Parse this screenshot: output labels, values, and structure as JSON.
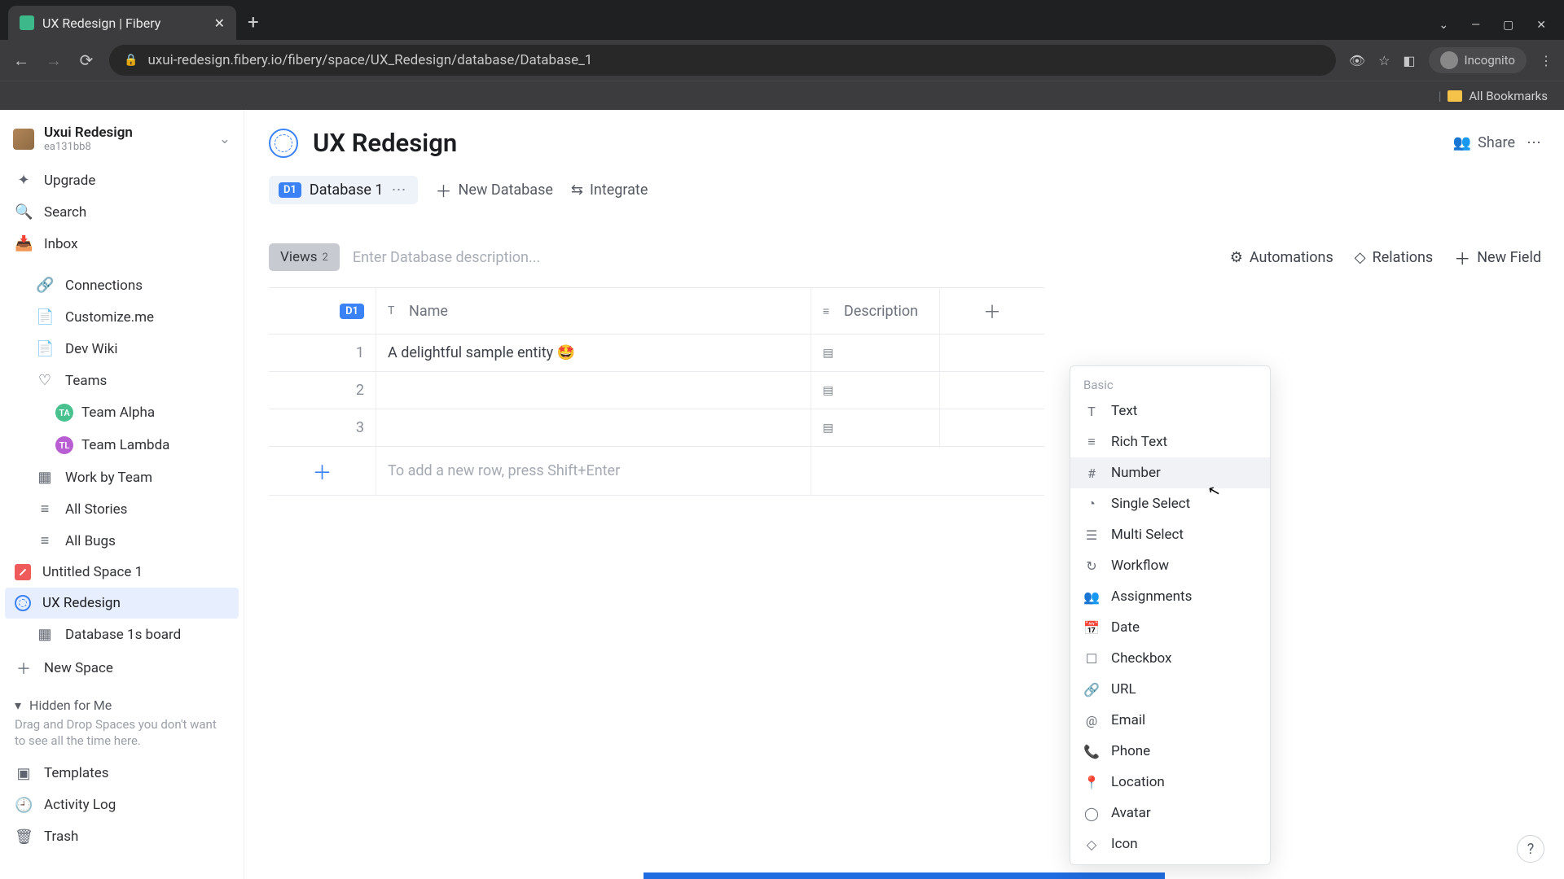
{
  "browser": {
    "tab_title": "UX Redesign | Fibery",
    "url": "uxui-redesign.fibery.io/fibery/space/UX_Redesign/database/Database_1",
    "incognito_label": "Incognito",
    "bookmarks_label": "All Bookmarks"
  },
  "workspace": {
    "name": "Uxui Redesign",
    "id": "ea131bb8"
  },
  "sidebar": {
    "upgrade": "Upgrade",
    "search": "Search",
    "inbox": "Inbox",
    "connections": "Connections",
    "customize": "Customize.me",
    "dev_wiki": "Dev Wiki",
    "teams": "Teams",
    "team_alpha": "Team Alpha",
    "team_alpha_abbr": "TA",
    "team_lambda": "Team Lambda",
    "team_lambda_abbr": "TL",
    "work_by_team": "Work by Team",
    "all_stories": "All Stories",
    "all_bugs": "All Bugs",
    "untitled_space": "Untitled Space 1",
    "ux_redesign": "UX Redesign",
    "db_board": "Database 1s board",
    "new_space": "New Space",
    "hidden_header": "Hidden for Me",
    "hidden_desc": "Drag and Drop Spaces you don't want to see all the time here.",
    "templates": "Templates",
    "activity_log": "Activity Log",
    "trash": "Trash"
  },
  "page": {
    "title": "UX Redesign",
    "share": "Share",
    "db_chip_badge": "D1",
    "db_chip_name": "Database 1",
    "new_database": "New Database",
    "integrate": "Integrate",
    "views_label": "Views",
    "views_count": "2",
    "desc_placeholder": "Enter Database description...",
    "automations": "Automations",
    "relations": "Relations",
    "new_field": "New Field"
  },
  "table": {
    "headers": {
      "name": "Name",
      "description": "Description",
      "d1_badge": "D1"
    },
    "rows": [
      {
        "num": "1",
        "name": "A delightful sample entity 🤩"
      },
      {
        "num": "2",
        "name": ""
      },
      {
        "num": "3",
        "name": ""
      }
    ],
    "add_row_hint": "To add a new row, press Shift+Enter"
  },
  "field_dropdown": {
    "group_basic": "Basic",
    "items": [
      {
        "label": "Text"
      },
      {
        "label": "Rich Text"
      },
      {
        "label": "Number",
        "hover": true
      },
      {
        "label": "Single Select"
      },
      {
        "label": "Multi Select"
      },
      {
        "label": "Workflow"
      },
      {
        "label": "Assignments"
      },
      {
        "label": "Date"
      },
      {
        "label": "Checkbox"
      },
      {
        "label": "URL"
      },
      {
        "label": "Email"
      },
      {
        "label": "Phone"
      },
      {
        "label": "Location"
      },
      {
        "label": "Avatar"
      },
      {
        "label": "Icon"
      }
    ]
  }
}
